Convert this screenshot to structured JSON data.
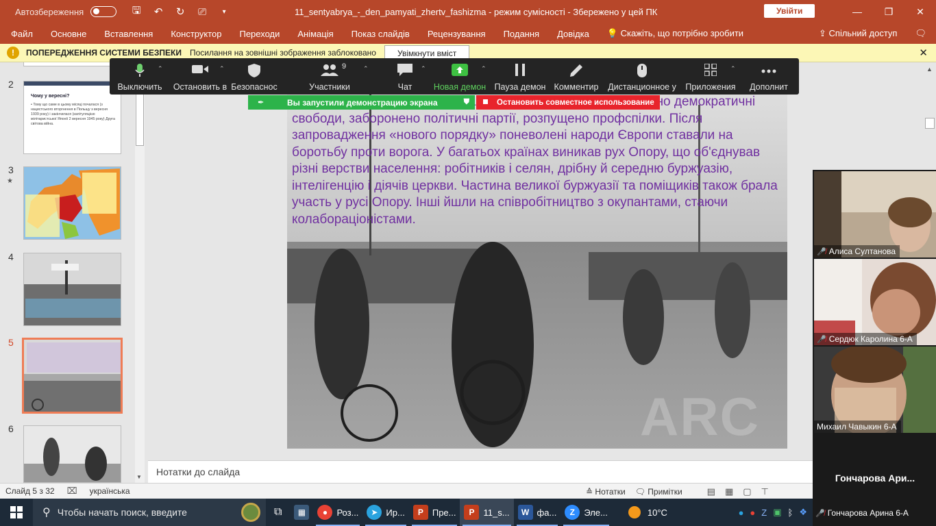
{
  "titlebar": {
    "autosave_label": "Автозбереження",
    "document_title": "11_sentyabrya_-_den_pamyati_zhertv_fashizma  -  режим сумісності  -  Збережено у цей ПК",
    "signin_label": "Увійти"
  },
  "ribbon": {
    "tabs": [
      "Файл",
      "Основне",
      "Вставлення",
      "Конструктор",
      "Переходи",
      "Анімація",
      "Показ слайдів",
      "Рецензування",
      "Подання",
      "Довідка"
    ],
    "tell_me": "Скажіть, що потрібно зробити",
    "share": "Спільний доступ"
  },
  "security": {
    "title": "ПОПЕРЕДЖЕННЯ СИСТЕМИ БЕЗПЕКИ",
    "message": "Посилання на зовнішні зображення заблоковано",
    "enable_button": "Увімкнути вміст"
  },
  "thumbnails": {
    "numbers": [
      "2",
      "3",
      "4",
      "5",
      "6"
    ],
    "slide2_title": "Чому у вересні?",
    "slide2_text": "• Тому що саме в цьому місяці почалася (з нацистського вторгнення в Польщу з вересня 1939 року) і закінчилася (капітуляцією мілітаристської Японії 2 вересня 1945 року) Друга світова війна."
  },
  "zoom": {
    "items": [
      {
        "label": "Выключить",
        "icon": "microphone-icon"
      },
      {
        "label": "Остановить в",
        "icon": "video-camera-icon"
      },
      {
        "label": "Безопаснос",
        "icon": "shield-icon"
      },
      {
        "label": "Участники",
        "icon": "participants-icon",
        "count": "9"
      },
      {
        "label": "Чат",
        "icon": "chat-icon"
      },
      {
        "label": "Новая демон",
        "icon": "share-screen-icon"
      },
      {
        "label": "Пауза демон",
        "icon": "pause-icon"
      },
      {
        "label": "Комментир",
        "icon": "pen-icon"
      },
      {
        "label": "Дистанционное у",
        "icon": "mouse-icon"
      },
      {
        "label": "Приложения",
        "icon": "apps-icon"
      },
      {
        "label": "Дополнит",
        "icon": "more-icon"
      }
    ],
    "share_banner": "Вы запустили демонстрацию экрана",
    "stop_banner": "Остановить совместное использование"
  },
  "slide": {
    "text": "онізму (співробітництва із загарбниками). Тут було ліквідовано демократичні свободи, заборонено політичні партії, розпущено профспілки. Після запровадження «нового порядку» поневолені народи Європи ставали на боротьбу проти ворога. У багатьох країнах виникав рух Опору, що об'єднував різні верстви населення: робітників і селян, дрібну й середню буржуазію, інтелігенцію і діячів церкви. Частина великої буржуазії та поміщиків також брала участь у русі Опору. Інші йшли на співробітництво з окупантами, стаючи колабораціоністами.",
    "watermark": "ARC"
  },
  "notes": {
    "placeholder": "Нотатки до слайда"
  },
  "status": {
    "slide_counter": "Слайд 5 з 32",
    "language": "українська",
    "notes_button": "Нотатки",
    "comments_button": "Примітки"
  },
  "gallery": {
    "participants": [
      "Алиса Султанова",
      "Сердюк Каролина 6-А",
      "Михаил Чавыкин 6-А"
    ],
    "name_tile": "Гончарова  Ари...",
    "last_name": "Гончарова Арина 6-А"
  },
  "taskbar": {
    "search_placeholder": "Чтобы начать поиск, введите",
    "apps": [
      {
        "label": "Роз...",
        "icon": "chrome-icon",
        "color": "#e94235"
      },
      {
        "label": "Ир...",
        "icon": "telegram-icon",
        "color": "#2aa3df"
      },
      {
        "label": "Пре...",
        "icon": "powerpoint-icon",
        "color": "#c43e1c"
      },
      {
        "label": "11_s...",
        "icon": "powerpoint-icon",
        "color": "#c43e1c"
      },
      {
        "label": "фа...",
        "icon": "word-icon",
        "color": "#2b579a"
      },
      {
        "label": "Эле...",
        "icon": "zoom-icon",
        "color": "#2d8cff"
      }
    ],
    "weather": "10°C"
  }
}
